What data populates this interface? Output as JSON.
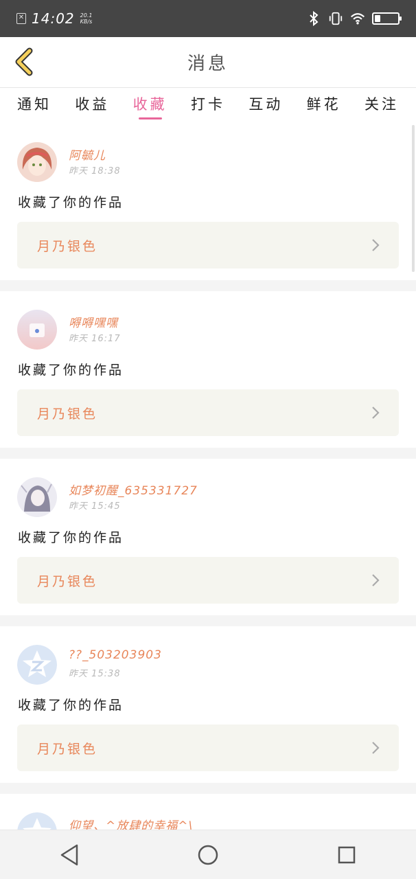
{
  "status_bar": {
    "time": "14:02",
    "speed_value": "20.1",
    "speed_unit": "KB/s",
    "battery": "23",
    "battery_level": 0.23
  },
  "header": {
    "title": "消息"
  },
  "tabs": [
    {
      "label": "通知",
      "active": false
    },
    {
      "label": "收益",
      "active": false
    },
    {
      "label": "收藏",
      "active": true
    },
    {
      "label": "打卡",
      "active": false
    },
    {
      "label": "互动",
      "active": false
    },
    {
      "label": "鲜花",
      "active": false
    },
    {
      "label": "关注",
      "active": false
    }
  ],
  "notifications": [
    {
      "username": "阿毓儿",
      "time": "昨天 18:38",
      "action": "收藏了你的作品",
      "work": "月乃银色"
    },
    {
      "username": "嘚嘚嘿嘿",
      "time": "昨天 16:17",
      "action": "收藏了你的作品",
      "work": "月乃银色"
    },
    {
      "username": "如梦初醒_635331727",
      "time": "昨天 15:45",
      "action": "收藏了你的作品",
      "work": "月乃银色"
    },
    {
      "username": "??_503203903",
      "time": "昨天 15:38",
      "action": "收藏了你的作品",
      "work": "月乃银色"
    },
    {
      "username": "仰望、^放肆的幸福^\\",
      "time": "",
      "action": "",
      "work": ""
    }
  ],
  "colors": {
    "accent": "#e8669a",
    "username": "#e8865a",
    "status_bar": "#454545"
  }
}
